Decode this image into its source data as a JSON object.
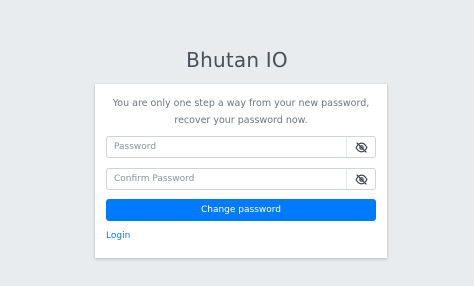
{
  "brand": {
    "title": "Bhutan IO"
  },
  "card": {
    "message": "You are only one step a way from your new password, recover your password now.",
    "password_field": {
      "placeholder": "Password",
      "value": "",
      "icon": "eye-slash-icon"
    },
    "confirm_field": {
      "placeholder": "Confirm Password",
      "value": "",
      "icon": "eye-slash-icon"
    },
    "submit_label": "Change password",
    "login_link": "Login"
  },
  "colors": {
    "accent": "#007bff",
    "background": "#e9ecef"
  }
}
